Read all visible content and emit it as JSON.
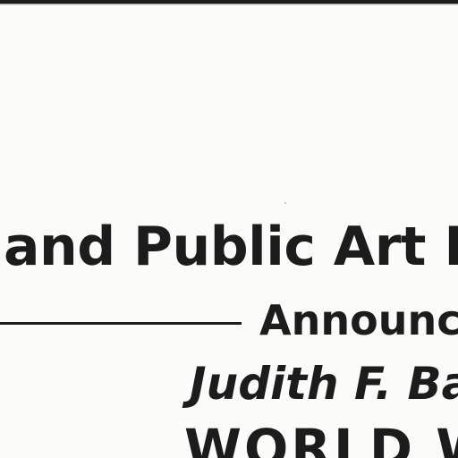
{
  "document": {
    "title_line": "and Public Art F",
    "announce_line": "Announce",
    "author_line": "Judith F. Ba",
    "heading_line": "WORLD W"
  }
}
